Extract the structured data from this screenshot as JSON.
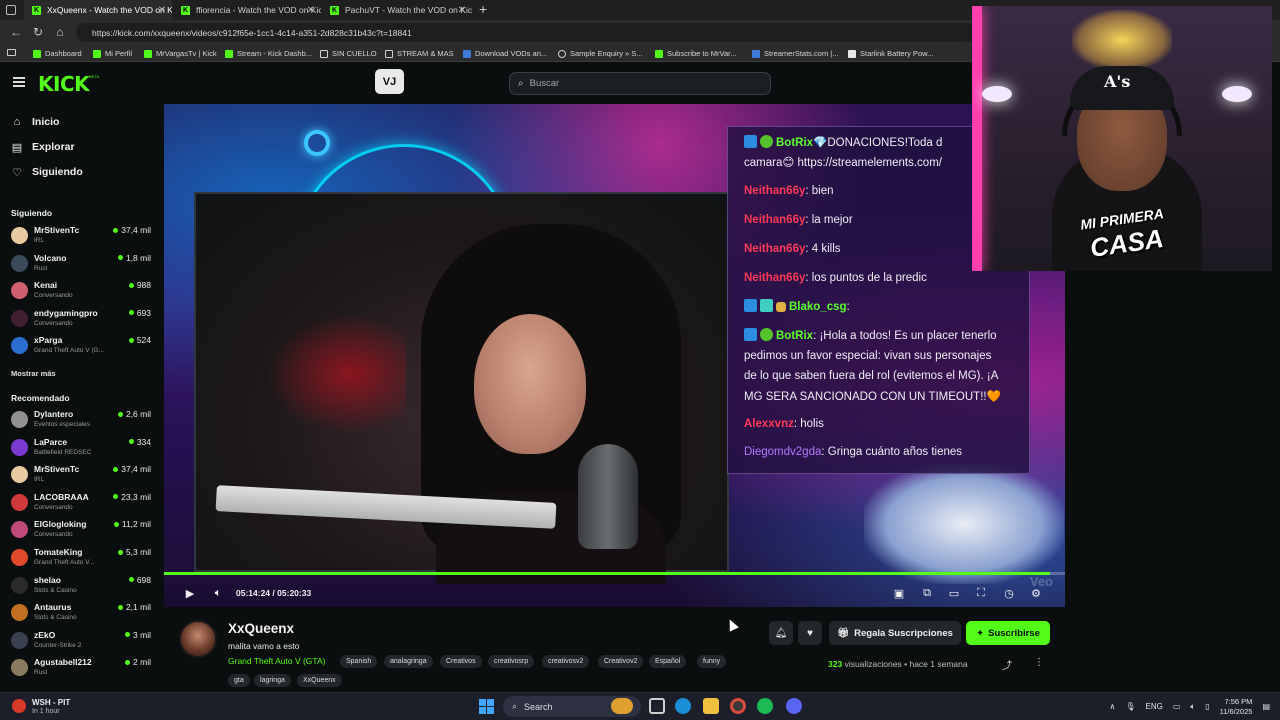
{
  "browser": {
    "tabs": [
      {
        "title": "XxQueenx - Watch the VOD on Kic",
        "active": true
      },
      {
        "title": "ffiorencia - Watch the VOD on Kic",
        "active": false
      },
      {
        "title": "PachuVT - Watch the VOD on Kic",
        "active": false
      }
    ],
    "new_tab": "+",
    "url": "https://kick.com/xxqueenx/videos/c912f65e-1cc1-4c14-a351-2d828c31b43c?t=18841",
    "bookmarks": [
      {
        "label": "Dashboard",
        "icon": "kick-icon"
      },
      {
        "label": "Mi Perfil",
        "icon": "kick-icon"
      },
      {
        "label": "MrVargasTv | Kick",
        "icon": "kick-icon"
      },
      {
        "label": "Stream - Kick Dashb...",
        "icon": "kick-icon"
      },
      {
        "label": "SIN CUELLO",
        "icon": "folder-icon"
      },
      {
        "label": "STREAM & MAS",
        "icon": "folder-icon"
      },
      {
        "label": "Download VODs an...",
        "icon": "blue-icon"
      },
      {
        "label": "Sample Enquiry » S...",
        "icon": "globe-icon"
      },
      {
        "label": "Subscribe to MrVar...",
        "icon": "kick-icon"
      },
      {
        "label": "StreamerStats.com |...",
        "icon": "blue-icon"
      },
      {
        "label": "Starlink Battery Pow...",
        "icon": "white-icon"
      }
    ]
  },
  "header": {
    "logo": "KICK",
    "logo_beta": "BETA",
    "center_icon": "VJ",
    "search_placeholder": "Buscar"
  },
  "sidebar": {
    "nav": [
      {
        "label": "Inicio",
        "icon": "home-icon"
      },
      {
        "label": "Explorar",
        "icon": "compass-icon"
      },
      {
        "label": "Siguiendo",
        "icon": "heart-icon"
      }
    ],
    "following_title": "Siguiendo",
    "following": [
      {
        "name": "MrStivenTc",
        "category": "IRL",
        "viewers": "37,4 mil",
        "color": "#e8c9a0"
      },
      {
        "name": "Volcano",
        "category": "Rust",
        "viewers": "1,8 mil",
        "color": "#3a4a5a"
      },
      {
        "name": "Kenai",
        "category": "Conversando",
        "viewers": "988",
        "color": "#d06070"
      },
      {
        "name": "endygamingpro",
        "category": "Conversando",
        "viewers": "693",
        "color": "#402030"
      },
      {
        "name": "xParga",
        "category": "Grand Theft Auto V (G...",
        "viewers": "524",
        "color": "#2a6fd0"
      }
    ],
    "show_more": "Mostrar más",
    "recommended_title": "Recomendado",
    "recommended": [
      {
        "name": "Dylantero",
        "category": "Eventos especiales",
        "viewers": "2,6 mil",
        "color": "#909090"
      },
      {
        "name": "LaParce",
        "category": "Battlefield REDSEC",
        "viewers": "334",
        "color": "#7a3ad0"
      },
      {
        "name": "MrStivenTc",
        "category": "IRL",
        "viewers": "37,4 mil",
        "color": "#e8c9a0"
      },
      {
        "name": "LACOBRAAA",
        "category": "Conversando",
        "viewers": "23,3 mil",
        "color": "#d03a3a"
      },
      {
        "name": "ElGlogloking",
        "category": "Conversando",
        "viewers": "11,2 mil",
        "color": "#c04a7a"
      },
      {
        "name": "TomateKing",
        "category": "Grand Theft Auto V...",
        "viewers": "5,3 mil",
        "color": "#e04a2a"
      },
      {
        "name": "shelao",
        "category": "Slots & Casino",
        "viewers": "698",
        "color": "#2a2a2a"
      },
      {
        "name": "Antaurus",
        "category": "Slots & Casino",
        "viewers": "2,1 mil",
        "color": "#c07020"
      },
      {
        "name": "zEkO",
        "category": "Counter-Strike 2",
        "viewers": "3 mil",
        "color": "#3a4050"
      },
      {
        "name": "Agustabell212",
        "category": "Rust",
        "viewers": "2 mil",
        "color": "#8a7a60"
      }
    ]
  },
  "player": {
    "time_current": "05:14:24",
    "time_total": "05:20:33",
    "time_separator": "/",
    "progress_fraction": 0.983,
    "watermark": "Veo",
    "chat": [
      {
        "user": "BotRix",
        "text": "💎DONACIONES!Toda d",
        "style": "bot",
        "badges": [
          "share",
          "verified"
        ]
      },
      {
        "user": "",
        "text": "camara😊 https://streamelements.com/",
        "style": "cont"
      },
      {
        "user": "Neithan66y",
        "text": ": bien",
        "style": "red"
      },
      {
        "user": "Neithan66y",
        "text": ": la mejor",
        "style": "red"
      },
      {
        "user": "Neithan66y",
        "text": ": 4 kills",
        "style": "red"
      },
      {
        "user": "Neithan66y",
        "text": ": los puntos de la predic",
        "style": "red"
      },
      {
        "user": "Blako_csg",
        "text": ":",
        "style": "bot",
        "badges": [
          "share",
          "mg",
          "crown"
        ]
      },
      {
        "user": "BotRix",
        "text": ": ¡Hola a todos! Es un placer tenerlo",
        "style": "bot",
        "badges": [
          "share",
          "verified"
        ]
      },
      {
        "user": "",
        "text": "pedimos un favor especial: vivan sus personajes",
        "style": "cont"
      },
      {
        "user": "",
        "text": "de lo que saben fuera del rol (evitemos el MG). ¡A",
        "style": "cont"
      },
      {
        "user": "",
        "text": "MG SERA SANCIONADO CON UN TIMEOUT!!🧡",
        "style": "cont"
      },
      {
        "user": "Alexxvnz",
        "text": ": holis",
        "style": "red"
      },
      {
        "user": "Diegomdv2gda",
        "text": ": Gringa cuánto años tienes",
        "style": "violet"
      }
    ]
  },
  "streamer_cam": {
    "cap_logo": "A's",
    "title_line_1": "MI PRIMERA",
    "title_line_2": "CASA"
  },
  "channel": {
    "name": "XxQueenx",
    "title": "malita vamo a esto",
    "category": "Grand Theft Auto V (GTA)",
    "tags": [
      "Spanish",
      "analagringa",
      "Creativos",
      "creativosrp",
      "creativosv2",
      "Creativov2",
      "Español",
      "funny",
      "gta",
      "lagringa",
      "XxQueenx"
    ],
    "gift_label": "Regala Suscripciones",
    "subscribe_label": "Suscribirse",
    "views_count": "323",
    "views_label": "visualizaciones",
    "views_sep": "•",
    "uploaded": "hace 1 semana"
  },
  "taskbar": {
    "weather_title": "WSH - PIT",
    "weather_sub": "In 1 hour",
    "search_label": "Search",
    "lang": "ENG",
    "time": "7:56 PM",
    "date": "11/6/2025"
  },
  "colors": {
    "kick_green": "#53fc18",
    "background": "#0b0e0f",
    "chat_red": "#ff3a57",
    "chat_violet": "#b07bff"
  }
}
